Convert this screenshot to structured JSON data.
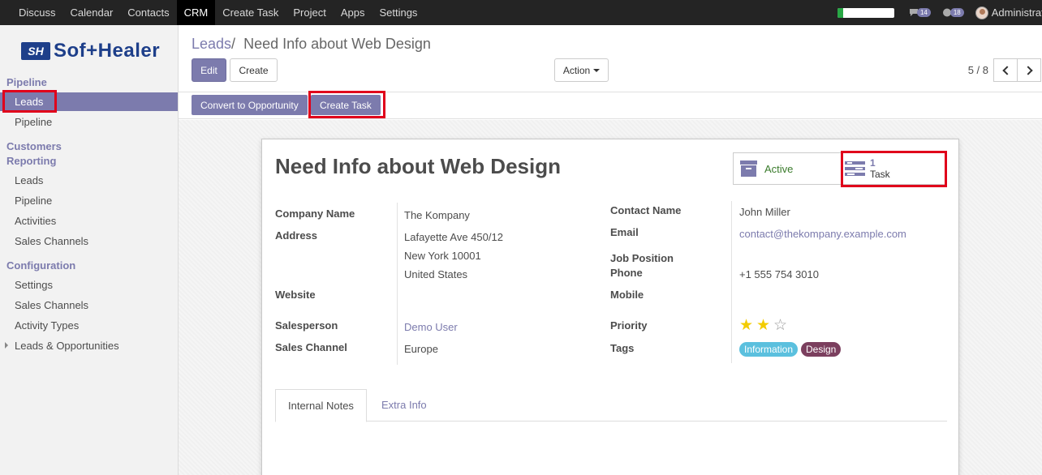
{
  "topnav": {
    "items": [
      "Discuss",
      "Calendar",
      "Contacts",
      "CRM",
      "Create Task",
      "Project",
      "Apps",
      "Settings"
    ],
    "active": "CRM",
    "loading_progress": 0.1,
    "messages_count": "14",
    "activities_count": "18",
    "user": "Administrato"
  },
  "sidebar": {
    "logo_mark": "SH",
    "logo_text": "Sof+Healer",
    "sections": {
      "pipeline": "Pipeline",
      "customers": "Customers",
      "reporting": "Reporting",
      "configuration": "Configuration"
    },
    "pipeline_items": [
      "Leads",
      "Pipeline"
    ],
    "reporting_items": [
      "Leads",
      "Pipeline",
      "Activities",
      "Sales Channels"
    ],
    "configuration_items": [
      "Settings",
      "Sales Channels",
      "Activity Types",
      "Leads & Opportunities"
    ]
  },
  "control_panel": {
    "breadcrumb_parent": "Leads",
    "breadcrumb_sep": "/",
    "breadcrumb_current": "Need Info about Web Design",
    "edit_label": "Edit",
    "create_label": "Create",
    "action_label": "Action",
    "pager": "5 / 8"
  },
  "statusbar": {
    "convert_label": "Convert to Opportunity",
    "create_task_label": "Create Task"
  },
  "sheet": {
    "title": "Need Info about Web Design",
    "smart_active": "Active",
    "smart_task_count": "1",
    "smart_task_label": "Task",
    "left_fields": {
      "company_label": "Company Name",
      "company_value": "The Kompany",
      "address_label": "Address",
      "address_line1": "Lafayette Ave 450/12",
      "address_line2": "New York 10001",
      "address_line3": "United States",
      "website_label": "Website",
      "salesperson_label": "Salesperson",
      "salesperson_value": "Demo User",
      "channel_label": "Sales Channel",
      "channel_value": "Europe"
    },
    "right_fields": {
      "contact_label": "Contact Name",
      "contact_value": "John Miller",
      "email_label": "Email",
      "email_value": "contact@thekompany.example.com",
      "job_label": "Job Position",
      "phone_label": "Phone",
      "phone_value": "+1 555 754 3010",
      "mobile_label": "Mobile",
      "priority_label": "Priority",
      "priority_value": 2,
      "priority_max": 3,
      "tags_label": "Tags",
      "tags": [
        "Information",
        "Design"
      ]
    },
    "tabs": [
      "Internal Notes",
      "Extra Info"
    ]
  },
  "colors": {
    "primary": "#7c7bad",
    "highlight": "#e0001b",
    "tag_information": "#5bc0de",
    "tag_design": "#7b3f5e",
    "star_on": "#f3cc00",
    "active_green": "#3a7b2b"
  }
}
